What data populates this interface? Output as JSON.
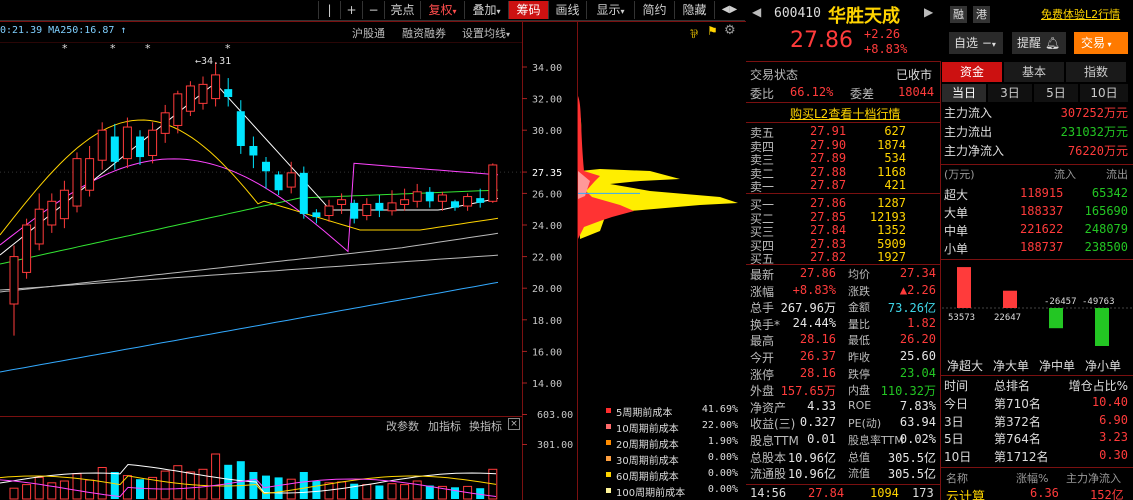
{
  "toolbar": {
    "nav": [
      "|",
      "+",
      "−"
    ],
    "buttons": [
      "亮点",
      "复权",
      "叠加",
      "筹码",
      "画线",
      "显示",
      "简约",
      "隐藏"
    ],
    "arrows": "◀▶"
  },
  "chart": {
    "ma_readout": "0:21.39  MA250:16.87 ↑",
    "sub_links": [
      "沪股通",
      "融资融券",
      "设置均线"
    ],
    "y_ticks": [
      "34.00",
      "32.00",
      "30.00",
      "27.35",
      "26.00",
      "24.00",
      "22.00",
      "20.00",
      "18.00",
      "16.00",
      "14.00"
    ],
    "peak_label": "←34.31",
    "indicator_links": [
      "改参数",
      "加指标",
      "换指标"
    ],
    "vol_ticks": [
      "603.00",
      "301.00"
    ],
    "colors": {
      "up": "#ff3b3b",
      "down": "#00e5ff",
      "ma5": "#ffffff",
      "ma10": "#ffd400",
      "ma20": "#ff44ff",
      "ma60": "#33e533",
      "ma120": "#bbbbbb",
      "ma250": "#33aaff"
    },
    "candles": [
      [
        19,
        22,
        17,
        22.7
      ],
      [
        21,
        24,
        20.6,
        24.4
      ],
      [
        22.8,
        25,
        22.4,
        26
      ],
      [
        24,
        25.5,
        23.5,
        26
      ],
      [
        24.4,
        26.2,
        23.8,
        26.8
      ],
      [
        25.2,
        28.2,
        24.8,
        28.6
      ],
      [
        26.2,
        28.2,
        25.8,
        29
      ],
      [
        28.1,
        30,
        27.5,
        30.5
      ],
      [
        29.6,
        28,
        27.5,
        30.4
      ],
      [
        28.2,
        30.2,
        27.6,
        30.8
      ],
      [
        29.6,
        28.3,
        27.8,
        30
      ],
      [
        28.4,
        30,
        27.9,
        30.5
      ],
      [
        29.8,
        31.1,
        29.2,
        31.6
      ],
      [
        30.3,
        32.3,
        29.8,
        32.5
      ],
      [
        31.2,
        32.8,
        30.9,
        33.1
      ],
      [
        31.7,
        32.9,
        31.3,
        33.4
      ],
      [
        32,
        33.5,
        31.5,
        34.31
      ],
      [
        32.6,
        32.1,
        31.5,
        33.3
      ],
      [
        31.2,
        29,
        28.5,
        31.9
      ],
      [
        29,
        28.4,
        27.6,
        29.6
      ],
      [
        28,
        27.4,
        26.3,
        28.3
      ],
      [
        27.2,
        26.2,
        25.9,
        27.4
      ],
      [
        26.4,
        27.3,
        26,
        28
      ],
      [
        27.3,
        24.7,
        24.4,
        27.7
      ],
      [
        24.8,
        24.5,
        24.1,
        25
      ],
      [
        24.6,
        25.2,
        24.2,
        25.6
      ],
      [
        25.3,
        25.6,
        24.7,
        26
      ],
      [
        25.4,
        24.4,
        24.1,
        25.6
      ],
      [
        24.6,
        25.3,
        24.3,
        25.7
      ],
      [
        25.4,
        24.9,
        24.5,
        25.9
      ],
      [
        24.9,
        25.4,
        24.6,
        26.2
      ],
      [
        25.3,
        25.6,
        24.9,
        26.3
      ],
      [
        25.5,
        26.1,
        25.1,
        26.6
      ],
      [
        26.1,
        25.5,
        25.1,
        26.4
      ],
      [
        25.5,
        25.9,
        24.9,
        26.1
      ],
      [
        25.5,
        25.1,
        24.9,
        25.6
      ],
      [
        25.2,
        25.8,
        24.9,
        26
      ],
      [
        25.7,
        25.4,
        25.1,
        26.3
      ],
      [
        25.5,
        27.8,
        25.4,
        27.9
      ]
    ],
    "volumes": [
      [
        120,
        1
      ],
      [
        160,
        1
      ],
      [
        240,
        1
      ],
      [
        180,
        1
      ],
      [
        200,
        1
      ],
      [
        280,
        1
      ],
      [
        210,
        1
      ],
      [
        350,
        1
      ],
      [
        300,
        0
      ],
      [
        260,
        1
      ],
      [
        220,
        0
      ],
      [
        240,
        1
      ],
      [
        310,
        1
      ],
      [
        370,
        1
      ],
      [
        300,
        1
      ],
      [
        330,
        1
      ],
      [
        500,
        1
      ],
      [
        380,
        0
      ],
      [
        420,
        0
      ],
      [
        300,
        0
      ],
      [
        260,
        0
      ],
      [
        240,
        0
      ],
      [
        220,
        1
      ],
      [
        300,
        0
      ],
      [
        200,
        0
      ],
      [
        180,
        1
      ],
      [
        190,
        1
      ],
      [
        170,
        0
      ],
      [
        160,
        1
      ],
      [
        150,
        0
      ],
      [
        170,
        1
      ],
      [
        160,
        1
      ],
      [
        200,
        1
      ],
      [
        150,
        0
      ],
      [
        140,
        1
      ],
      [
        130,
        0
      ],
      [
        140,
        1
      ],
      [
        120,
        0
      ],
      [
        330,
        1
      ]
    ]
  },
  "chips": {
    "legend": [
      {
        "label": "5周期前成本",
        "value": "41.69%",
        "color": "#ff2d2d"
      },
      {
        "label": "10周期前成本",
        "value": "22.00%",
        "color": "#ff6a6a"
      },
      {
        "label": "20周期前成本",
        "value": "1.90%",
        "color": "#ff8c00"
      },
      {
        "label": "30周期前成本",
        "value": "0.00%",
        "color": "#ffa040"
      },
      {
        "label": "60周期前成本",
        "value": "0.00%",
        "color": "#ffd400"
      },
      {
        "label": "100周期前成本",
        "value": "0.00%",
        "color": "#fff59a"
      }
    ]
  },
  "quote": {
    "code": "600410",
    "name": "华胜天成",
    "badges": [
      "融",
      "港"
    ],
    "l2_link": "免费体验L2行情",
    "price": "27.86",
    "change": "+2.26",
    "change_pct": "+8.83%",
    "buttons": [
      "自选",
      "提醒",
      "交易"
    ],
    "status_label": "交易状态",
    "status_value": "已收市",
    "weibi_label": "委比",
    "weibi_value": "66.12%",
    "weicha_label": "委差",
    "weicha_value": "18044",
    "buy_l2": "购买L2查看十档行情",
    "sells": [
      {
        "label": "卖五",
        "price": "27.91",
        "vol": "627"
      },
      {
        "label": "卖四",
        "price": "27.90",
        "vol": "1874"
      },
      {
        "label": "卖三",
        "price": "27.89",
        "vol": "534"
      },
      {
        "label": "卖二",
        "price": "27.88",
        "vol": "1168"
      },
      {
        "label": "卖一",
        "price": "27.87",
        "vol": "421"
      }
    ],
    "buys": [
      {
        "label": "买一",
        "price": "27.86",
        "vol": "1287"
      },
      {
        "label": "买二",
        "price": "27.85",
        "vol": "12193"
      },
      {
        "label": "买三",
        "price": "27.84",
        "vol": "1352"
      },
      {
        "label": "买四",
        "price": "27.83",
        "vol": "5909"
      },
      {
        "label": "买五",
        "price": "27.82",
        "vol": "1927"
      }
    ],
    "stats": [
      {
        "l1": "最新",
        "v1": "27.86",
        "c1": "red",
        "l2": "均价",
        "v2": "27.34",
        "c2": "red"
      },
      {
        "l1": "涨幅",
        "v1": "+8.83%",
        "c1": "red",
        "l2": "涨跌",
        "v2": "▲2.26",
        "c2": "red"
      },
      {
        "l1": "总手",
        "v1": "267.96万",
        "c1": "white",
        "l2": "金额",
        "v2": "73.26亿",
        "c2": "cyan"
      },
      {
        "l1": "换手*",
        "v1": "24.44%",
        "c1": "white",
        "l2": "量比",
        "v2": "1.82",
        "c2": "red"
      },
      {
        "l1": "最高",
        "v1": "28.16",
        "c1": "red",
        "l2": "最低",
        "v2": "26.20",
        "c2": "red"
      },
      {
        "l1": "今开",
        "v1": "26.37",
        "c1": "red",
        "l2": "昨收",
        "v2": "25.60",
        "c2": "white"
      },
      {
        "l1": "涨停",
        "v1": "28.16",
        "c1": "red",
        "l2": "跌停",
        "v2": "23.04",
        "c2": "green"
      },
      {
        "l1": "外盘",
        "v1": "157.65万",
        "c1": "red",
        "l2": "内盘",
        "v2": "110.32万",
        "c2": "green"
      },
      {
        "l1": "净资产",
        "v1": "4.33",
        "c1": "white",
        "l2": "ROE",
        "v2": "7.83%",
        "c2": "white"
      },
      {
        "l1": "收益(三)",
        "v1": "0.327",
        "c1": "white",
        "l2": "PE(动)",
        "v2": "63.94",
        "c2": "white"
      },
      {
        "l1": "股息TTM",
        "v1": "0.01",
        "c1": "white",
        "l2": "股息率TTM",
        "v2": "0.02%",
        "c2": "white"
      },
      {
        "l1": "总股本",
        "v1": "10.96亿",
        "c1": "white",
        "l2": "总值",
        "v2": "305.5亿",
        "c2": "white"
      },
      {
        "l1": "流通股",
        "v1": "10.96亿",
        "c1": "white",
        "l2": "流值",
        "v2": "305.5亿",
        "c2": "white"
      }
    ],
    "tick": {
      "time": "14:56",
      "price": "27.84",
      "vol": "1094",
      "num": "173"
    }
  },
  "fund": {
    "tabs": [
      "资金",
      "基本",
      "指数"
    ],
    "periods": [
      "当日",
      "3日",
      "5日",
      "10日"
    ],
    "flows": [
      {
        "label": "主力流入",
        "value": "307252万元",
        "color": "red"
      },
      {
        "label": "主力流出",
        "value": "231032万元",
        "color": "green"
      },
      {
        "label": "主力净流入",
        "value": "76220万元",
        "color": "red"
      }
    ],
    "table_head": [
      "(万元)",
      "流入",
      "流出"
    ],
    "table": [
      {
        "label": "超大",
        "in": "118915",
        "out": "65342"
      },
      {
        "label": "大单",
        "in": "188337",
        "out": "165690"
      },
      {
        "label": "中单",
        "in": "221622",
        "out": "248079"
      },
      {
        "label": "小单",
        "in": "188737",
        "out": "238500"
      }
    ],
    "bars": [
      {
        "label": "净超大",
        "value": 53573,
        "text": "53573"
      },
      {
        "label": "净大单",
        "value": 22647,
        "text": "22647"
      },
      {
        "label": "净中单",
        "value": -26457,
        "text": "-26457"
      },
      {
        "label": "净小单",
        "value": -49763,
        "text": "-49763"
      }
    ],
    "rank_head": [
      "时间",
      "总排名",
      "增仓占比%"
    ],
    "ranks": [
      {
        "t": "今日",
        "r": "第710名",
        "v": "10.40"
      },
      {
        "t": "3日",
        "r": "第372名",
        "v": "6.90"
      },
      {
        "t": "5日",
        "r": "第764名",
        "v": "3.23"
      },
      {
        "t": "10日",
        "r": "第1712名",
        "v": "0.30"
      }
    ],
    "footer_head": [
      "名称",
      "涨幅%",
      "主力净流入"
    ],
    "footer": {
      "name": "云计算",
      "pct": "6.36",
      "flow": "152亿"
    }
  }
}
